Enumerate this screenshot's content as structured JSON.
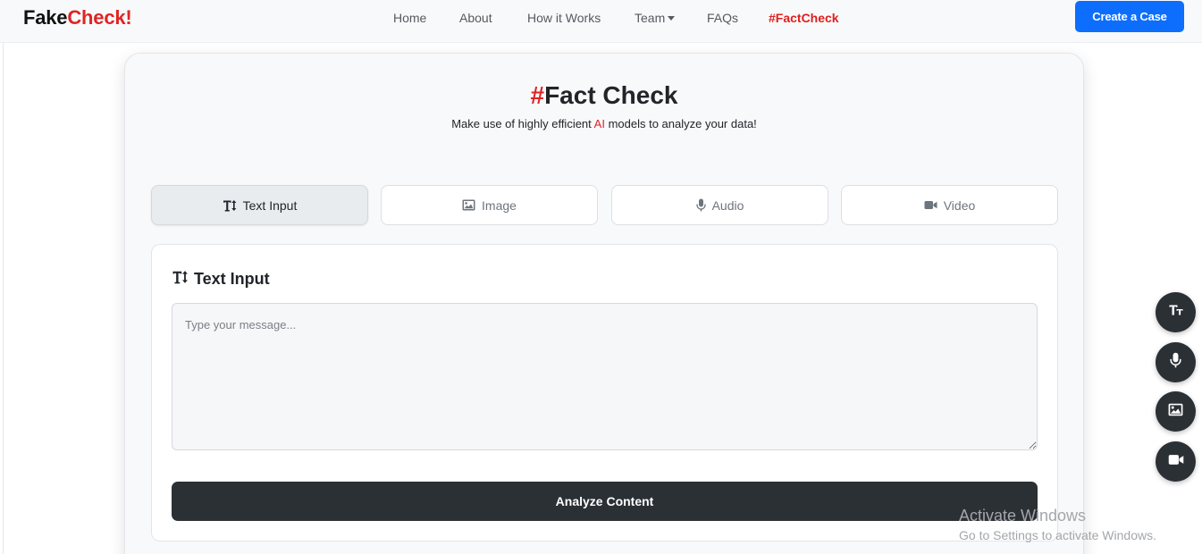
{
  "navbar": {
    "brand": {
      "part1": "Fake",
      "part2": "Check",
      "part3": "!"
    },
    "links": [
      {
        "label": "Home"
      },
      {
        "label": "About"
      },
      {
        "label": "How it Works"
      },
      {
        "label": "Team"
      },
      {
        "label": "FAQs"
      },
      {
        "label": "#FactCheck"
      }
    ],
    "cta_label": "Create a Case"
  },
  "hero": {
    "title_hash": "#",
    "title_text": "Fact Check",
    "subtitle_before": "Make use of highly efficient ",
    "subtitle_ai": "AI",
    "subtitle_after": " models to analyze your data!"
  },
  "tabs": [
    {
      "label": "Text Input",
      "icon": "text-height-icon",
      "active": true
    },
    {
      "label": "Image",
      "icon": "image-icon",
      "active": false
    },
    {
      "label": "Audio",
      "icon": "microphone-icon",
      "active": false
    },
    {
      "label": "Video",
      "icon": "video-camera-icon",
      "active": false
    }
  ],
  "panel": {
    "title": "Text Input",
    "placeholder": "Type your message...",
    "value": "",
    "analyze_label": "Analyze Content"
  },
  "fabs": [
    "text-size-icon",
    "microphone-icon",
    "image-icon",
    "video-camera-icon"
  ],
  "watermark": {
    "line1": "Activate Windows",
    "line2": "Go to Settings to activate Windows."
  },
  "colors": {
    "accent_red": "#e02424",
    "primary_blue": "#0d6efd",
    "dark": "#2b3035"
  }
}
